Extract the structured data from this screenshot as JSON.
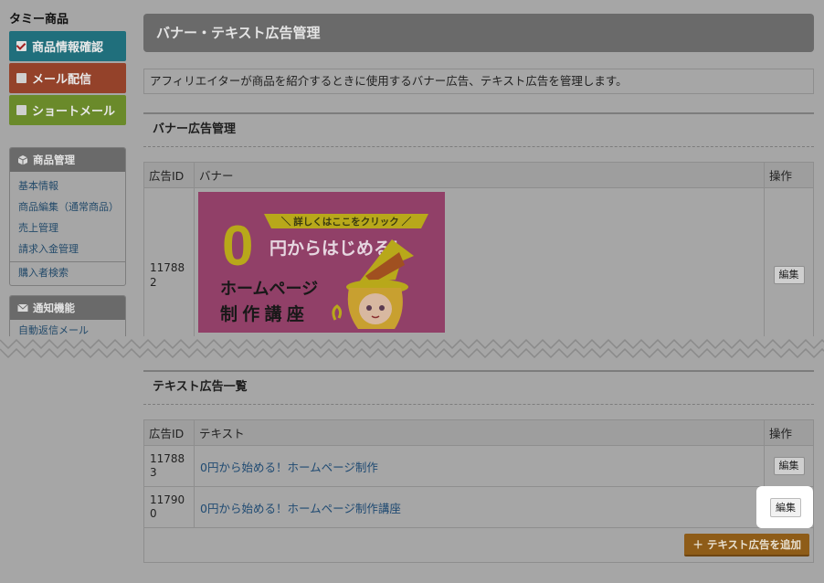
{
  "sidebar": {
    "product_name": "タミー商品",
    "nav": [
      {
        "label": "商品情報確認",
        "checked": true,
        "color": "#206f7c"
      },
      {
        "label": "メール配信",
        "checked": false,
        "color": "#94422a"
      },
      {
        "label": "ショートメール",
        "checked": false,
        "color": "#6a8a2a"
      }
    ],
    "product_mgmt": {
      "title": "商品管理",
      "icon": "box-icon",
      "links": [
        "基本情報",
        "商品編集（通常商品）",
        "売上管理",
        "請求入金管理",
        "購入者検索"
      ]
    },
    "notify": {
      "title": "通知機能",
      "icon": "mail-icon",
      "links": [
        "自動返信メール"
      ]
    }
  },
  "main": {
    "title": "バナー・テキスト広告管理",
    "description": "アフィリエイターが商品を紹介するときに使用するバナー広告、テキスト広告を管理します。",
    "banner_section": {
      "heading": "バナー広告管理",
      "columns": [
        "広告ID",
        "バナー",
        "操作"
      ],
      "rows": [
        {
          "id": "117882",
          "edit": "編集"
        }
      ],
      "banner": {
        "ribbon": "＼ 詳しくはここをクリック ／",
        "big_zero": "0",
        "headline": "円からはじめる！",
        "line1": "ホームページ",
        "line2": "制 作 講 座"
      }
    },
    "text_section": {
      "heading": "テキスト広告一覧",
      "columns": [
        "広告ID",
        "テキスト",
        "操作"
      ],
      "rows": [
        {
          "id": "117883",
          "text": "0円から始める！ホームページ制作",
          "edit": "編集"
        },
        {
          "id": "117900",
          "text": "0円から始める！ホームページ制作講座",
          "edit": "編集"
        }
      ],
      "add_button": "＋ テキスト広告を追加"
    }
  },
  "colors": {
    "overlay": "#a6a6a6",
    "highlight": "#ffffff",
    "banner_bg": "#914068",
    "accent_yellow": "#b8a81a"
  }
}
